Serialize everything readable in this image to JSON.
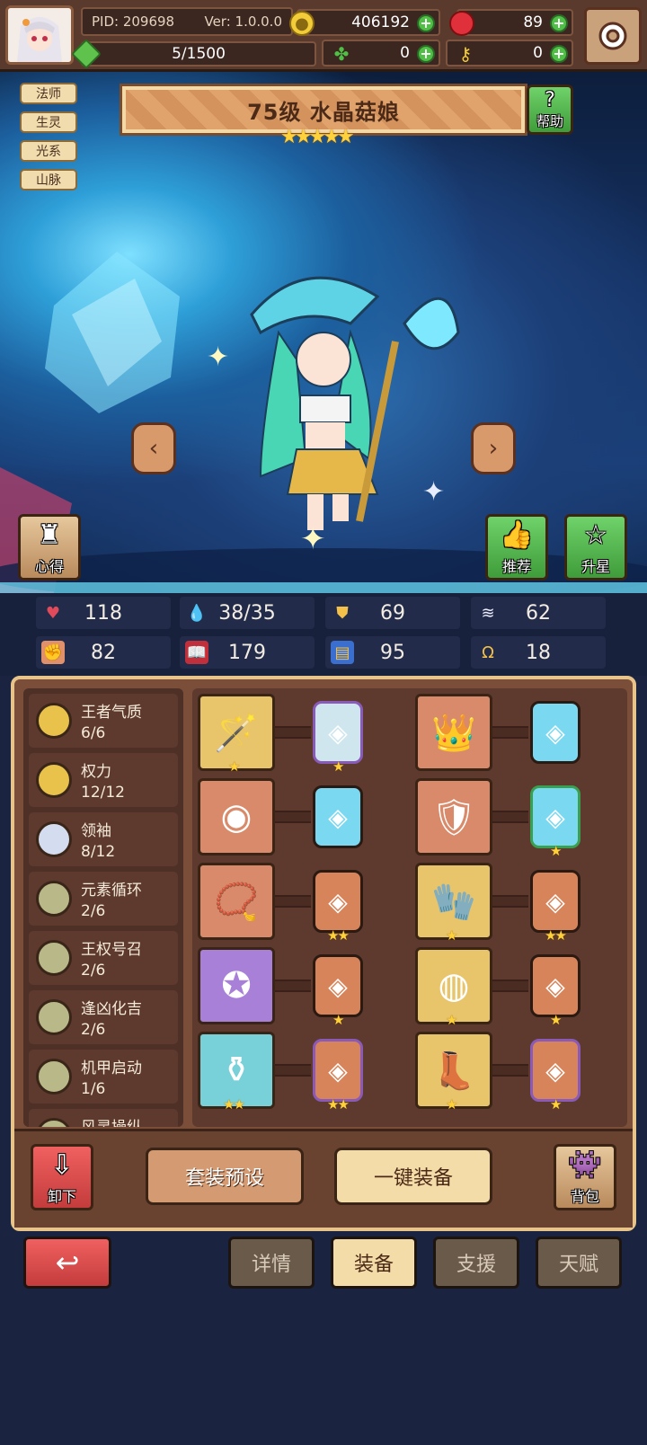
{
  "top": {
    "pid": "PID: 209698",
    "ver": "Ver: 1.0.0.0",
    "gold": "406192",
    "gems": "89",
    "energy": "5/1500",
    "clover": "0",
    "key": "0"
  },
  "character": {
    "title": "75级 水晶菇娘",
    "stars": "★★★★★",
    "tags": [
      "法师",
      "生灵",
      "光系",
      "山脉"
    ],
    "help": "帮助",
    "insight": "心得",
    "recommend": "推荐",
    "upgrade_star": "升星"
  },
  "stats": [
    "118",
    "38/35",
    "69",
    "62",
    "82",
    "179",
    "95",
    "18"
  ],
  "sets": [
    {
      "name": "王者气质",
      "count": "6/6"
    },
    {
      "name": "权力",
      "count": "12/12"
    },
    {
      "name": "领袖",
      "count": "8/12"
    },
    {
      "name": "元素循环",
      "count": "2/6"
    },
    {
      "name": "王权号召",
      "count": "2/6"
    },
    {
      "name": "逢凶化吉",
      "count": "2/6"
    },
    {
      "name": "机甲启动",
      "count": "1/6"
    },
    {
      "name": "风灵操纵",
      "count": ""
    }
  ],
  "slot_stars": {
    "r1a": "★",
    "r1b": "★",
    "r2d": "★",
    "r3b": "★★",
    "r3c": "★",
    "r3d": "★★",
    "r4b": "★",
    "r4c": "★",
    "r4d": "★",
    "r5a": "★★",
    "r5b": "★★",
    "r5c": "★",
    "r5d": "★"
  },
  "buttons": {
    "unequip": "卸下",
    "preset": "套装预设",
    "auto_equip": "一键装备",
    "bag": "背包"
  },
  "tabs": [
    "详情",
    "装备",
    "支援",
    "天赋"
  ],
  "colors": {
    "accent": "#e8c48a",
    "bg": "#1a2340",
    "gold": "#ffd23c"
  }
}
